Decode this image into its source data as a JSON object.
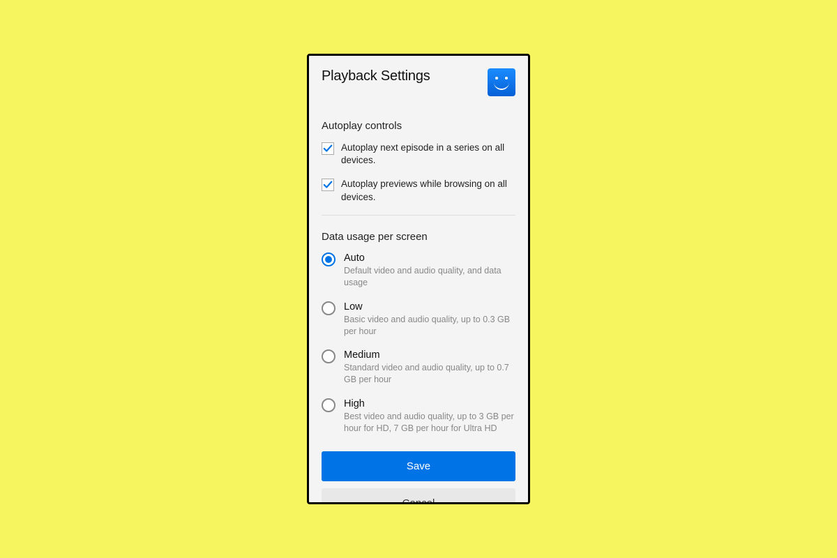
{
  "header": {
    "title": "Playback Settings"
  },
  "autoplay": {
    "section_title": "Autoplay controls",
    "items": [
      {
        "label": "Autoplay next episode in a series on all devices.",
        "checked": true
      },
      {
        "label": "Autoplay previews while browsing on all devices.",
        "checked": true
      }
    ]
  },
  "data_usage": {
    "section_title": "Data usage per screen",
    "options": [
      {
        "title": "Auto",
        "desc": "Default video and audio quality, and data usage",
        "selected": true
      },
      {
        "title": "Low",
        "desc": "Basic video and audio quality, up to 0.3 GB per hour",
        "selected": false
      },
      {
        "title": "Medium",
        "desc": "Standard video and audio quality, up to 0.7 GB per hour",
        "selected": false
      },
      {
        "title": "High",
        "desc": "Best video and audio quality, up to 3 GB per hour for HD, 7 GB per hour for Ultra HD",
        "selected": false
      }
    ]
  },
  "buttons": {
    "save": "Save",
    "cancel": "Cancel"
  }
}
